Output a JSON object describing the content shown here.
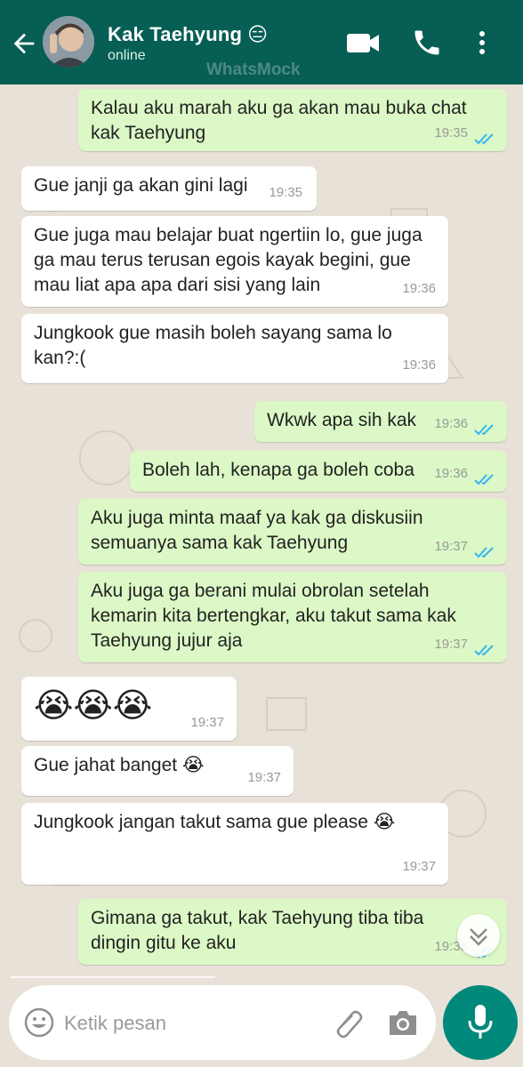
{
  "header": {
    "contact_name": "Kak Taehyung",
    "status_emoji": "😑",
    "status": "online",
    "watermark": "WhatsMock",
    "icons": [
      "back-arrow-icon",
      "video-call-icon",
      "phone-icon",
      "more-options-icon"
    ]
  },
  "messages": [
    {
      "dir": "out",
      "text": "Kalau aku marah aku ga akan mau buka chat kak Taehyung",
      "time": "19:35",
      "read": true
    },
    {
      "dir": "in",
      "text": "Gue janji ga akan gini lagi",
      "time": "19:35"
    },
    {
      "dir": "in",
      "text": "Gue juga mau belajar buat ngertiin lo, gue juga ga mau terus terusan egois kayak begini, gue mau liat apa apa dari sisi yang lain",
      "time": "19:36"
    },
    {
      "dir": "in",
      "text": "Jungkook gue masih boleh sayang sama lo kan?:(",
      "time": "19:36"
    },
    {
      "dir": "out",
      "text": "Wkwk apa sih kak",
      "time": "19:36",
      "read": true
    },
    {
      "dir": "out",
      "text": "Boleh lah, kenapa ga boleh coba",
      "time": "19:36",
      "read": true
    },
    {
      "dir": "out",
      "text": "Aku juga minta maaf ya kak ga diskusiin semuanya sama kak Taehyung",
      "time": "19:37",
      "read": true
    },
    {
      "dir": "out",
      "text": "Aku juga ga berani mulai obrolan setelah kemarin kita bertengkar, aku takut sama kak Taehyung jujur aja",
      "time": "19:37",
      "read": true
    },
    {
      "dir": "in",
      "text": "😭😭😭",
      "time": "19:37"
    },
    {
      "dir": "in",
      "text": "Gue jahat banget 😭",
      "time": "19:37"
    },
    {
      "dir": "in",
      "text": "Jungkook jangan takut sama gue please 😭",
      "time": "19:37"
    },
    {
      "dir": "out",
      "text": "Gimana ga takut, kak Taehyung tiba tiba dingin gitu ke aku",
      "time": "19:38",
      "read": true
    }
  ],
  "composer": {
    "placeholder": "Ketik pesan",
    "icons": [
      "emoji-icon",
      "attach-icon",
      "camera-icon",
      "mic-icon",
      "scroll-down-icon"
    ]
  },
  "colors": {
    "header": "#075e54",
    "outgoing_bubble": "#dcf8c6",
    "incoming_bubble": "#ffffff",
    "read_ticks": "#34b7f1",
    "mic_button": "#00897b",
    "chat_background": "#e8e1d7"
  }
}
